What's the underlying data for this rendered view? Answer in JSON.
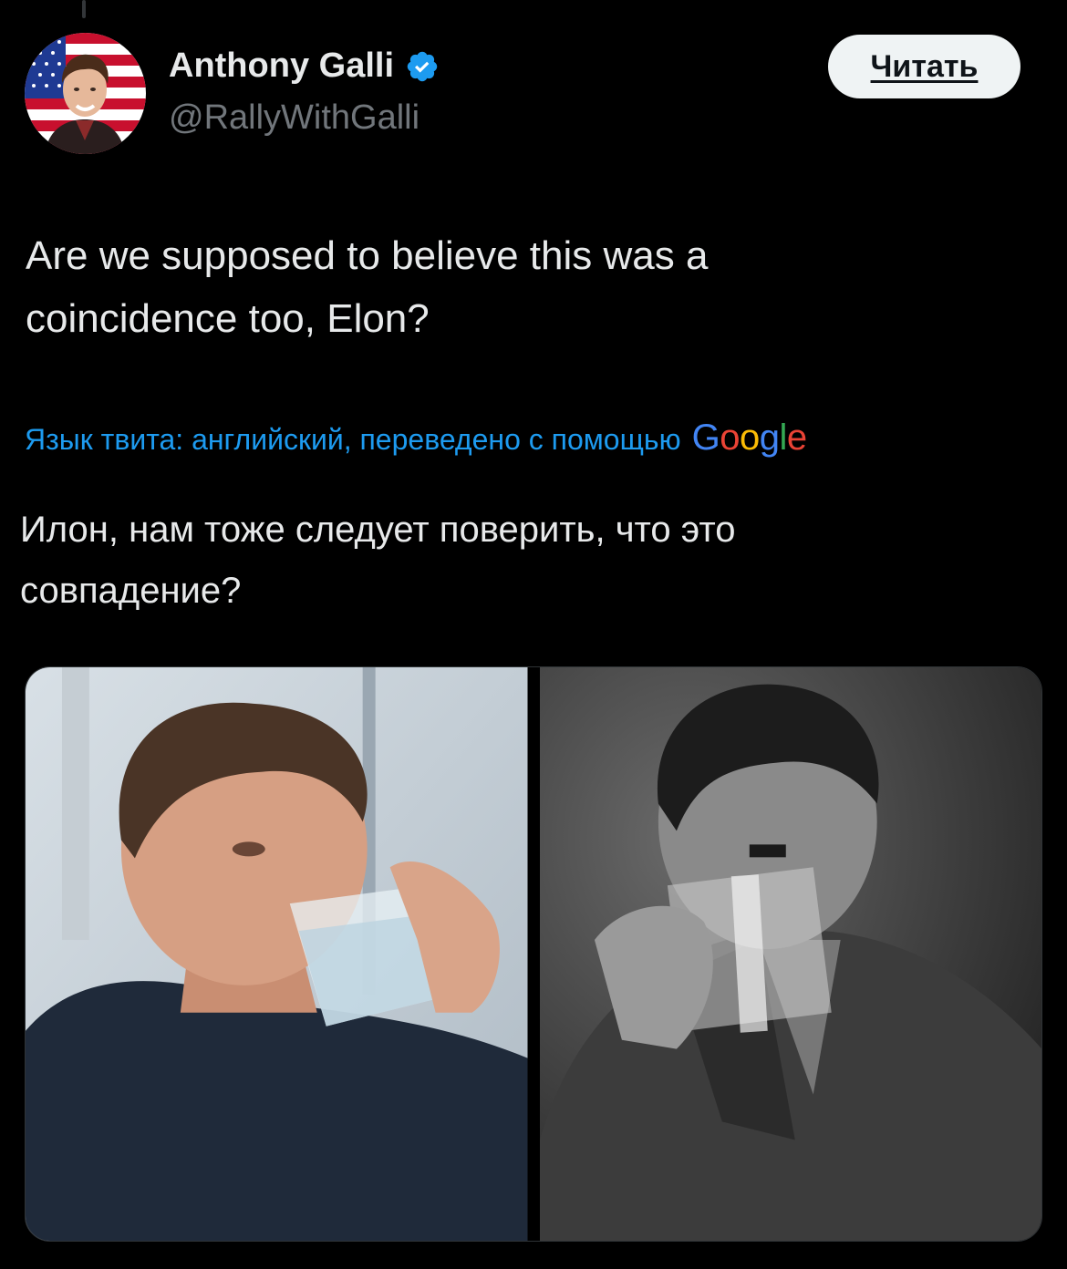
{
  "tweet": {
    "author": {
      "name": "Anthony Galli",
      "handle": "@RallyWithGalli",
      "verified": true,
      "verified_color": "#1d9bf0"
    },
    "follow_button_label": "Читать",
    "text_line_1": "Are we supposed to believe this was a",
    "text_line_2": "coincidence too, Elon?",
    "translation": {
      "note": "Язык твита: английский, переведено с помощью",
      "provider_letters": [
        "G",
        "o",
        "o",
        "g",
        "l",
        "e"
      ],
      "text_line_1": "Илон, нам тоже следует поверить, что это",
      "text_line_2": "совпадение?"
    },
    "media": [
      {
        "icon": "photo-icon",
        "description_color": "#c9d2d8"
      },
      {
        "icon": "photo-icon",
        "description_color": "#4a4a4a"
      }
    ]
  },
  "colors": {
    "background": "#000000",
    "text": "#e7e9ea",
    "secondary_text": "#71767b",
    "link": "#1d9bf0",
    "button_bg": "#eff3f4"
  }
}
